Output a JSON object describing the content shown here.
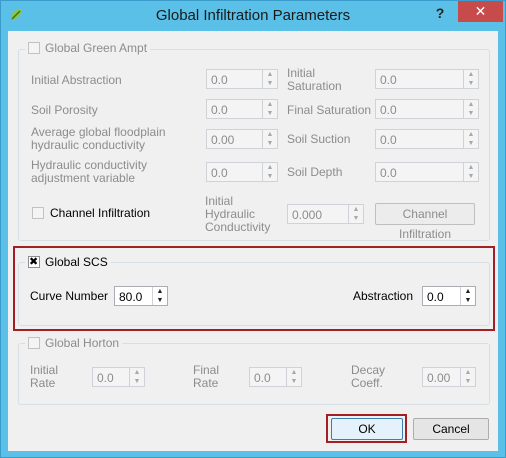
{
  "dialog": {
    "title": "Global Infiltration Parameters",
    "help": "?",
    "close": "✕"
  },
  "green_ampt": {
    "label": "Global Green Ampt",
    "checked": false,
    "initial_abstraction": {
      "label": "Initial Abstraction",
      "value": "0.0"
    },
    "initial_saturation": {
      "label": "Initial Saturation",
      "value": "0.0"
    },
    "soil_porosity": {
      "label": "Soil Porosity",
      "value": "0.0"
    },
    "final_saturation": {
      "label": "Final Saturation",
      "value": "0.0"
    },
    "avg_floodplain_hc": {
      "label": "Average global floodplain hydraulic conductivity",
      "value": "0.00"
    },
    "soil_suction": {
      "label": "Soil Suction",
      "value": "0.0"
    },
    "hc_adjustment": {
      "label": "Hydraulic conductivity adjustment variable",
      "value": "0.0"
    },
    "soil_depth": {
      "label": "Soil Depth",
      "value": "0.0"
    },
    "channel_infiltration": {
      "label": "Channel Infiltration",
      "checked": false
    },
    "initial_hc": {
      "label": "Initial Hydraulic Conductivity",
      "value": "0.000"
    },
    "channel_infiltration_button": "Channel Infiltration"
  },
  "scs": {
    "label": "Global SCS",
    "checked": true,
    "curve_number": {
      "label": "Curve Number",
      "value": "80.0"
    },
    "abstraction": {
      "label": "Abstraction",
      "value": "0.0"
    }
  },
  "horton": {
    "label": "Global Horton",
    "checked": false,
    "initial_rate": {
      "label": "Initial Rate",
      "value": "0.0"
    },
    "final_rate": {
      "label": "Final Rate",
      "value": "0.0"
    },
    "decay_coeff": {
      "label": "Decay Coeff.",
      "value": "0.00"
    }
  },
  "buttons": {
    "ok": "OK",
    "cancel": "Cancel"
  },
  "colors": {
    "titlebar": "#5ac0e8",
    "close": "#c74b4b",
    "highlight": "#a31f24"
  }
}
